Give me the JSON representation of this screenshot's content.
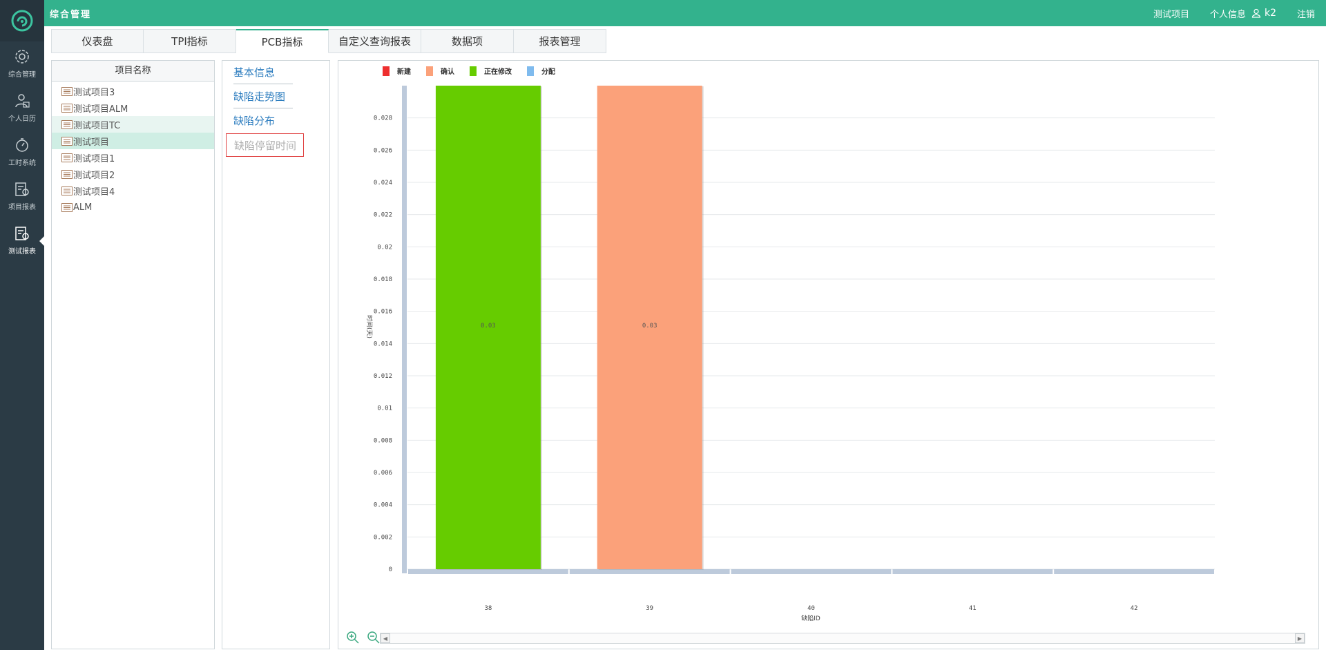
{
  "app": {
    "title": "综合管理"
  },
  "rail": {
    "items": [
      {
        "label": "综合管理",
        "icon": "gear-icon"
      },
      {
        "label": "个人日历",
        "icon": "user-calendar-icon"
      },
      {
        "label": "工时系统",
        "icon": "stopwatch-icon"
      },
      {
        "label": "项目报表",
        "icon": "chart-report-icon"
      },
      {
        "label": "测试报表",
        "icon": "test-report-icon"
      }
    ]
  },
  "header": {
    "project": "测试项目",
    "profile": "个人信息",
    "user": "k2",
    "logout": "注销"
  },
  "tabs": [
    {
      "label": "仪表盘"
    },
    {
      "label": "TPI指标"
    },
    {
      "label": "PCB指标",
      "active": true
    },
    {
      "label": "自定义查询报表"
    },
    {
      "label": "数据项"
    },
    {
      "label": "报表管理"
    }
  ],
  "projects": {
    "header": "项目名称",
    "items": [
      {
        "label": "测试项目3"
      },
      {
        "label": "测试项目ALM"
      },
      {
        "label": "测试项目TC"
      },
      {
        "label": "测试项目"
      },
      {
        "label": "测试项目1"
      },
      {
        "label": "测试项目2"
      },
      {
        "label": "测试项目4"
      },
      {
        "label": "ALM"
      }
    ]
  },
  "subnav": {
    "basic": "基本信息",
    "trend": "缺陷走势图",
    "distribution": "缺陷分布",
    "dwell": "缺陷停留时间"
  },
  "colors": {
    "brand": "#33b28d",
    "rail": "#2b3b45",
    "link": "#2d7dbf"
  },
  "chart_data": {
    "type": "bar",
    "legend": [
      {
        "name": "新建",
        "color": "#ee2f2f"
      },
      {
        "name": "确认",
        "color": "#fba17a"
      },
      {
        "name": "正在修改",
        "color": "#66cc00"
      },
      {
        "name": "分配",
        "color": "#7fbbee"
      }
    ],
    "categories": [
      "38",
      "39",
      "40",
      "41",
      "42"
    ],
    "series": [
      {
        "name": "正在修改",
        "values": [
          0.03,
          null,
          null,
          null,
          null
        ]
      },
      {
        "name": "确认",
        "values": [
          null,
          0.03,
          null,
          null,
          null
        ]
      }
    ],
    "data_labels": [
      "0.03",
      "0.03"
    ],
    "xlabel": "缺陷ID",
    "ylabel": "时间(天)",
    "yticks": [
      "0",
      "0.002",
      "0.004",
      "0.006",
      "0.008",
      "0.01",
      "0.012",
      "0.014",
      "0.016",
      "0.018",
      "0.02",
      "0.022",
      "0.024",
      "0.026",
      "0.028"
    ],
    "ylim": [
      0,
      0.03
    ],
    "grid": true,
    "legend_position": "top-left"
  }
}
